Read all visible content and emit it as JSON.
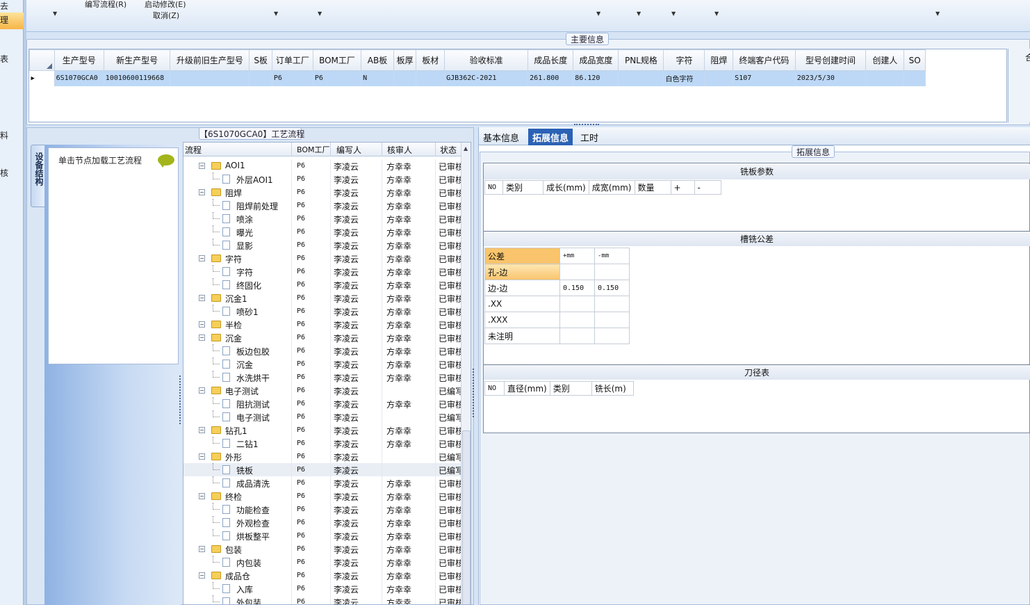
{
  "leftnav": {
    "items": [
      "去",
      "理",
      "表",
      "料",
      "核"
    ]
  },
  "toolbar": {
    "menu1": "编写流程(R)",
    "menu2": "启动修改(E)",
    "menu3": "取消(Z)"
  },
  "main_info": {
    "title": "主要信息",
    "columns": [
      "生产型号",
      "新生产型号",
      "升级前旧生产型号",
      "S板",
      "订单工厂",
      "BOM工厂",
      "AB板",
      "板厚",
      "板材",
      "验收标准",
      "成品长度",
      "成品宽度",
      "PNL规格",
      "字符",
      "阻焊",
      "终端客户代码",
      "型号创建时间",
      "创建人",
      "SO"
    ],
    "row": [
      "6S1070GCA0",
      "10010600119668",
      "",
      "",
      "P6",
      "P6",
      "N",
      "",
      "",
      "GJB362C-2021",
      "261.800",
      "86.120",
      "",
      "白色字符",
      "",
      "S107",
      "2023/5/30",
      "",
      ""
    ]
  },
  "process": {
    "title": "【6S1070GCA0】工艺流程",
    "side_tab": "设备结构",
    "load_hint": "单击节点加载工艺流程",
    "headers": {
      "flow": "流程",
      "bom": "BOM工厂",
      "writer": "编写人",
      "checker": "核审人",
      "status": "状态"
    },
    "rows": [
      {
        "name": "AOI1",
        "level": 1,
        "bom": "P6",
        "w": "李凌云",
        "c": "方幸幸",
        "s": "已审核"
      },
      {
        "name": "外层AOI1",
        "level": 2,
        "bom": "P6",
        "w": "李凌云",
        "c": "方幸幸",
        "s": "已审核"
      },
      {
        "name": "阻焊",
        "level": 1,
        "bom": "P6",
        "w": "李凌云",
        "c": "方幸幸",
        "s": "已审核"
      },
      {
        "name": "阻焊前处理",
        "level": 2,
        "bom": "P6",
        "w": "李凌云",
        "c": "方幸幸",
        "s": "已审核"
      },
      {
        "name": "喷涂",
        "level": 2,
        "bom": "P6",
        "w": "李凌云",
        "c": "方幸幸",
        "s": "已审核"
      },
      {
        "name": "曝光",
        "level": 2,
        "bom": "P6",
        "w": "李凌云",
        "c": "方幸幸",
        "s": "已审核"
      },
      {
        "name": "显影",
        "level": 2,
        "bom": "P6",
        "w": "李凌云",
        "c": "方幸幸",
        "s": "已审核"
      },
      {
        "name": "字符",
        "level": 1,
        "bom": "P6",
        "w": "李凌云",
        "c": "方幸幸",
        "s": "已审核"
      },
      {
        "name": "字符",
        "level": 2,
        "bom": "P6",
        "w": "李凌云",
        "c": "方幸幸",
        "s": "已审核"
      },
      {
        "name": "终固化",
        "level": 2,
        "bom": "P6",
        "w": "李凌云",
        "c": "方幸幸",
        "s": "已审核"
      },
      {
        "name": "沉金1",
        "level": 1,
        "bom": "P6",
        "w": "李凌云",
        "c": "方幸幸",
        "s": "已审核"
      },
      {
        "name": "喷砂1",
        "level": 2,
        "bom": "P6",
        "w": "李凌云",
        "c": "方幸幸",
        "s": "已审核"
      },
      {
        "name": "半检",
        "level": 1,
        "bom": "P6",
        "w": "李凌云",
        "c": "方幸幸",
        "s": "已审核"
      },
      {
        "name": "沉金",
        "level": 1,
        "bom": "P6",
        "w": "李凌云",
        "c": "方幸幸",
        "s": "已审核"
      },
      {
        "name": "板边包胶",
        "level": 2,
        "bom": "P6",
        "w": "李凌云",
        "c": "方幸幸",
        "s": "已审核"
      },
      {
        "name": "沉金",
        "level": 2,
        "bom": "P6",
        "w": "李凌云",
        "c": "方幸幸",
        "s": "已审核"
      },
      {
        "name": "水洗烘干",
        "level": 2,
        "bom": "P6",
        "w": "李凌云",
        "c": "方幸幸",
        "s": "已审核"
      },
      {
        "name": "电子测试",
        "level": 1,
        "bom": "P6",
        "w": "李凌云",
        "c": "",
        "s": "已编写"
      },
      {
        "name": "阻抗测试",
        "level": 2,
        "bom": "P6",
        "w": "李凌云",
        "c": "方幸幸",
        "s": "已审核"
      },
      {
        "name": "电子测试",
        "level": 2,
        "bom": "P6",
        "w": "李凌云",
        "c": "",
        "s": "已编写"
      },
      {
        "name": "钻孔1",
        "level": 1,
        "bom": "P6",
        "w": "李凌云",
        "c": "方幸幸",
        "s": "已审核"
      },
      {
        "name": "二钻1",
        "level": 2,
        "bom": "P6",
        "w": "李凌云",
        "c": "方幸幸",
        "s": "已审核"
      },
      {
        "name": "外形",
        "level": 1,
        "bom": "P6",
        "w": "李凌云",
        "c": "",
        "s": "已编写"
      },
      {
        "name": "铣板",
        "level": 2,
        "bom": "P6",
        "w": "李凌云",
        "c": "",
        "s": "已编写"
      },
      {
        "name": "成品清洗",
        "level": 2,
        "bom": "P6",
        "w": "李凌云",
        "c": "方幸幸",
        "s": "已审核"
      },
      {
        "name": "终检",
        "level": 1,
        "bom": "P6",
        "w": "李凌云",
        "c": "方幸幸",
        "s": "已审核"
      },
      {
        "name": "功能检查",
        "level": 2,
        "bom": "P6",
        "w": "李凌云",
        "c": "方幸幸",
        "s": "已审核"
      },
      {
        "name": "外观检查",
        "level": 2,
        "bom": "P6",
        "w": "李凌云",
        "c": "方幸幸",
        "s": "已审核"
      },
      {
        "name": "烘板整平",
        "level": 2,
        "bom": "P6",
        "w": "李凌云",
        "c": "方幸幸",
        "s": "已审核"
      },
      {
        "name": "包装",
        "level": 1,
        "bom": "P6",
        "w": "李凌云",
        "c": "方幸幸",
        "s": "已审核"
      },
      {
        "name": "内包装",
        "level": 2,
        "bom": "P6",
        "w": "李凌云",
        "c": "方幸幸",
        "s": "已审核"
      },
      {
        "name": "成品仓",
        "level": 1,
        "bom": "P6",
        "w": "李凌云",
        "c": "方幸幸",
        "s": "已审核"
      },
      {
        "name": "入库",
        "level": 2,
        "bom": "P6",
        "w": "李凌云",
        "c": "方幸幸",
        "s": "已审核"
      },
      {
        "name": "外包装",
        "level": 2,
        "bom": "P6",
        "w": "李凌云",
        "c": "方幸幸",
        "s": "已审核"
      }
    ],
    "selected_index": 23
  },
  "tabs": [
    "基本信息",
    "拓展信息",
    "工时"
  ],
  "active_tab": 1,
  "ext": {
    "title": "拓展信息",
    "mill_params": {
      "title": "铣板参数",
      "headers": [
        "NO",
        "类别",
        "成长(mm)",
        "成宽(mm)",
        "数量",
        "+",
        "-"
      ]
    },
    "tolerance": {
      "title": "槽铣公差",
      "headers": [
        "公差",
        "+mm",
        "-mm"
      ],
      "rows": [
        {
          "label": "孔-边",
          "plus": "",
          "minus": ""
        },
        {
          "label": "边-边",
          "plus": "0.150",
          "minus": "0.150"
        },
        {
          "label": ".XX",
          "plus": "",
          "minus": ""
        },
        {
          "label": ".XXX",
          "plus": "",
          "minus": ""
        },
        {
          "label": "未注明",
          "plus": "",
          "minus": ""
        }
      ]
    },
    "cutter": {
      "title": "刀径表",
      "headers": [
        "NO",
        "直径(mm)",
        "类别",
        "铣长(m)"
      ]
    }
  },
  "colors": {
    "selected_row": "#bcd8f6",
    "active_tab": "#2b62b5",
    "highlight_cell": "#f9c46b"
  }
}
